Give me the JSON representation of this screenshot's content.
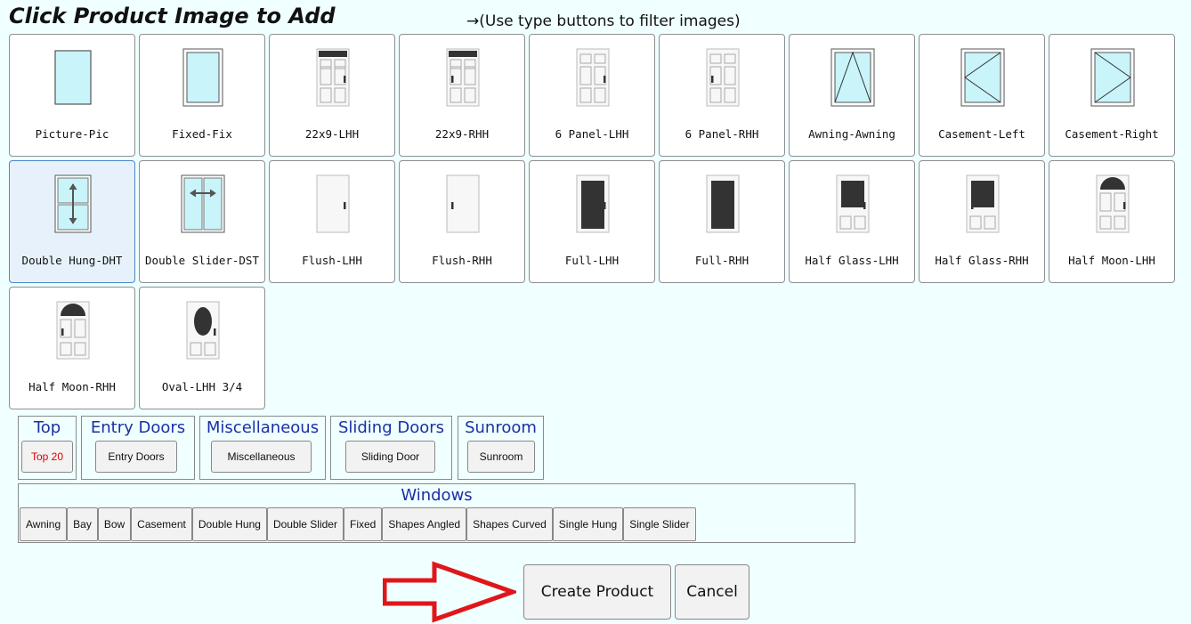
{
  "header": {
    "title": "Click Product Image to Add",
    "hint": "→(Use type buttons to filter images)"
  },
  "products": [
    {
      "label": "Picture-Pic",
      "icon": "picture-window-icon"
    },
    {
      "label": "Fixed-Fix",
      "icon": "fixed-window-icon"
    },
    {
      "label": "22x9-LHH",
      "icon": "door-22x9-left-icon"
    },
    {
      "label": "22x9-RHH",
      "icon": "door-22x9-right-icon"
    },
    {
      "label": "6 Panel-LHH",
      "icon": "door-6-panel-left-icon"
    },
    {
      "label": "6 Panel-RHH",
      "icon": "door-6-panel-right-icon"
    },
    {
      "label": "Awning-Awning",
      "icon": "awning-window-icon"
    },
    {
      "label": "Casement-Left",
      "icon": "casement-left-window-icon"
    },
    {
      "label": "Casement-Right",
      "icon": "casement-right-window-icon"
    },
    {
      "label": "Double Hung-DHT",
      "icon": "double-hung-window-icon",
      "selected": true
    },
    {
      "label": "Double Slider-DST",
      "icon": "double-slider-window-icon"
    },
    {
      "label": "Flush-LHH",
      "icon": "flush-door-left-icon"
    },
    {
      "label": "Flush-RHH",
      "icon": "flush-door-right-icon"
    },
    {
      "label": "Full-LHH",
      "icon": "full-glass-door-left-icon"
    },
    {
      "label": "Full-RHH",
      "icon": "full-glass-door-right-icon"
    },
    {
      "label": "Half Glass-LHH",
      "icon": "half-glass-door-left-icon"
    },
    {
      "label": "Half Glass-RHH",
      "icon": "half-glass-door-right-icon"
    },
    {
      "label": "Half Moon-LHH",
      "icon": "half-moon-door-left-icon"
    },
    {
      "label": "Half Moon-RHH",
      "icon": "half-moon-door-right-icon"
    },
    {
      "label": "Oval-LHH 3/4",
      "icon": "oval-door-left-icon"
    }
  ],
  "categories": {
    "top": {
      "title": "Top",
      "button": "Top 20"
    },
    "entry": {
      "title": "Entry Doors",
      "button": "Entry Doors"
    },
    "misc": {
      "title": "Miscellaneous",
      "button": "Miscellaneous"
    },
    "sliding": {
      "title": "Sliding Doors",
      "button": "Sliding Door"
    },
    "sunroom": {
      "title": "Sunroom",
      "button": "Sunroom"
    }
  },
  "windows": {
    "title": "Windows",
    "buttons": [
      "Awning",
      "Bay",
      "Bow",
      "Casement",
      "Double Hung",
      "Double Slider",
      "Fixed",
      "Shapes Angled",
      "Shapes Curved",
      "Single Hung",
      "Single Slider"
    ]
  },
  "actions": {
    "create": "Create Product",
    "cancel": "Cancel"
  },
  "colors": {
    "page_background": "#f0ffff",
    "category_title": "#1c2fa6",
    "top20_text": "#e00000",
    "annotation_arrow": "#e0161a",
    "glass": "#c8f4fa"
  }
}
